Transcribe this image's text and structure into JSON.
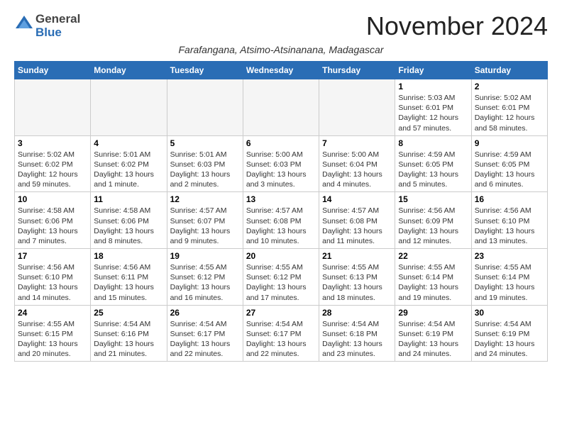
{
  "header": {
    "logo_general": "General",
    "logo_blue": "Blue",
    "month_title": "November 2024",
    "subtitle": "Farafangana, Atsimo-Atsinanana, Madagascar"
  },
  "days_of_week": [
    "Sunday",
    "Monday",
    "Tuesday",
    "Wednesday",
    "Thursday",
    "Friday",
    "Saturday"
  ],
  "weeks": [
    [
      {
        "day": "",
        "info": ""
      },
      {
        "day": "",
        "info": ""
      },
      {
        "day": "",
        "info": ""
      },
      {
        "day": "",
        "info": ""
      },
      {
        "day": "",
        "info": ""
      },
      {
        "day": "1",
        "info": "Sunrise: 5:03 AM\nSunset: 6:01 PM\nDaylight: 12 hours and 57 minutes."
      },
      {
        "day": "2",
        "info": "Sunrise: 5:02 AM\nSunset: 6:01 PM\nDaylight: 12 hours and 58 minutes."
      }
    ],
    [
      {
        "day": "3",
        "info": "Sunrise: 5:02 AM\nSunset: 6:02 PM\nDaylight: 12 hours and 59 minutes."
      },
      {
        "day": "4",
        "info": "Sunrise: 5:01 AM\nSunset: 6:02 PM\nDaylight: 13 hours and 1 minute."
      },
      {
        "day": "5",
        "info": "Sunrise: 5:01 AM\nSunset: 6:03 PM\nDaylight: 13 hours and 2 minutes."
      },
      {
        "day": "6",
        "info": "Sunrise: 5:00 AM\nSunset: 6:03 PM\nDaylight: 13 hours and 3 minutes."
      },
      {
        "day": "7",
        "info": "Sunrise: 5:00 AM\nSunset: 6:04 PM\nDaylight: 13 hours and 4 minutes."
      },
      {
        "day": "8",
        "info": "Sunrise: 4:59 AM\nSunset: 6:05 PM\nDaylight: 13 hours and 5 minutes."
      },
      {
        "day": "9",
        "info": "Sunrise: 4:59 AM\nSunset: 6:05 PM\nDaylight: 13 hours and 6 minutes."
      }
    ],
    [
      {
        "day": "10",
        "info": "Sunrise: 4:58 AM\nSunset: 6:06 PM\nDaylight: 13 hours and 7 minutes."
      },
      {
        "day": "11",
        "info": "Sunrise: 4:58 AM\nSunset: 6:06 PM\nDaylight: 13 hours and 8 minutes."
      },
      {
        "day": "12",
        "info": "Sunrise: 4:57 AM\nSunset: 6:07 PM\nDaylight: 13 hours and 9 minutes."
      },
      {
        "day": "13",
        "info": "Sunrise: 4:57 AM\nSunset: 6:08 PM\nDaylight: 13 hours and 10 minutes."
      },
      {
        "day": "14",
        "info": "Sunrise: 4:57 AM\nSunset: 6:08 PM\nDaylight: 13 hours and 11 minutes."
      },
      {
        "day": "15",
        "info": "Sunrise: 4:56 AM\nSunset: 6:09 PM\nDaylight: 13 hours and 12 minutes."
      },
      {
        "day": "16",
        "info": "Sunrise: 4:56 AM\nSunset: 6:10 PM\nDaylight: 13 hours and 13 minutes."
      }
    ],
    [
      {
        "day": "17",
        "info": "Sunrise: 4:56 AM\nSunset: 6:10 PM\nDaylight: 13 hours and 14 minutes."
      },
      {
        "day": "18",
        "info": "Sunrise: 4:56 AM\nSunset: 6:11 PM\nDaylight: 13 hours and 15 minutes."
      },
      {
        "day": "19",
        "info": "Sunrise: 4:55 AM\nSunset: 6:12 PM\nDaylight: 13 hours and 16 minutes."
      },
      {
        "day": "20",
        "info": "Sunrise: 4:55 AM\nSunset: 6:12 PM\nDaylight: 13 hours and 17 minutes."
      },
      {
        "day": "21",
        "info": "Sunrise: 4:55 AM\nSunset: 6:13 PM\nDaylight: 13 hours and 18 minutes."
      },
      {
        "day": "22",
        "info": "Sunrise: 4:55 AM\nSunset: 6:14 PM\nDaylight: 13 hours and 19 minutes."
      },
      {
        "day": "23",
        "info": "Sunrise: 4:55 AM\nSunset: 6:14 PM\nDaylight: 13 hours and 19 minutes."
      }
    ],
    [
      {
        "day": "24",
        "info": "Sunrise: 4:55 AM\nSunset: 6:15 PM\nDaylight: 13 hours and 20 minutes."
      },
      {
        "day": "25",
        "info": "Sunrise: 4:54 AM\nSunset: 6:16 PM\nDaylight: 13 hours and 21 minutes."
      },
      {
        "day": "26",
        "info": "Sunrise: 4:54 AM\nSunset: 6:17 PM\nDaylight: 13 hours and 22 minutes."
      },
      {
        "day": "27",
        "info": "Sunrise: 4:54 AM\nSunset: 6:17 PM\nDaylight: 13 hours and 22 minutes."
      },
      {
        "day": "28",
        "info": "Sunrise: 4:54 AM\nSunset: 6:18 PM\nDaylight: 13 hours and 23 minutes."
      },
      {
        "day": "29",
        "info": "Sunrise: 4:54 AM\nSunset: 6:19 PM\nDaylight: 13 hours and 24 minutes."
      },
      {
        "day": "30",
        "info": "Sunrise: 4:54 AM\nSunset: 6:19 PM\nDaylight: 13 hours and 24 minutes."
      }
    ]
  ]
}
